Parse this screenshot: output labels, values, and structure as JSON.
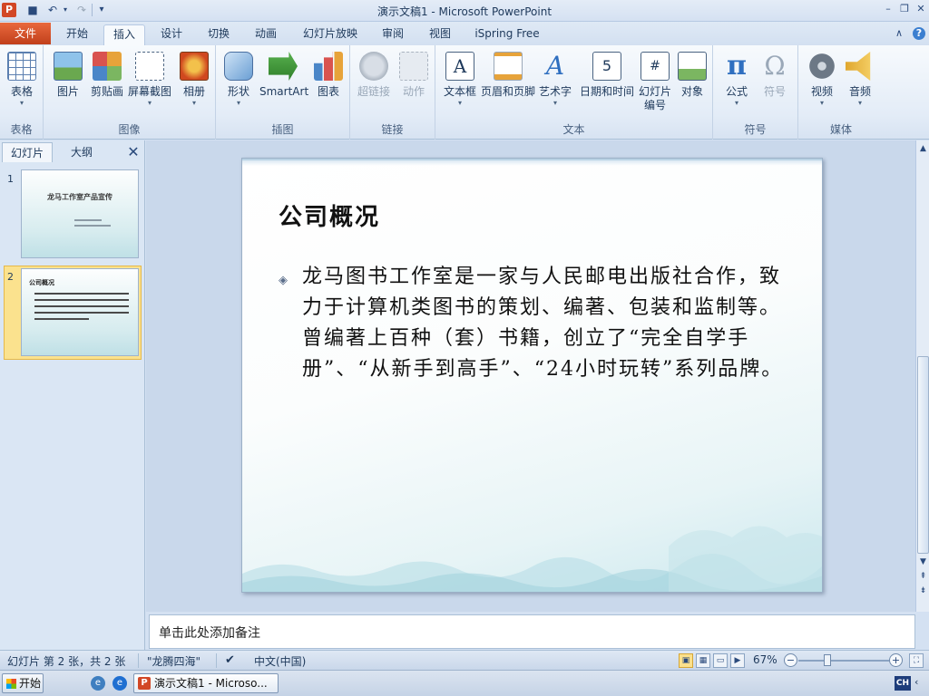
{
  "window": {
    "title": "演示文稿1 - Microsoft PowerPoint",
    "app_icon": "P",
    "qat": {
      "save_icon": "■",
      "undo_icon": "↶",
      "redo_icon": "↷",
      "customize_icon": "▾"
    },
    "controls": {
      "minimize": "–",
      "restore": "❐",
      "close": "✕"
    }
  },
  "tabs": {
    "file": "文件",
    "items": [
      "开始",
      "插入",
      "设计",
      "切换",
      "动画",
      "幻灯片放映",
      "审阅",
      "视图",
      "iSpring Free"
    ],
    "active_index": 1,
    "collapse_icon": "∧",
    "help_icon": "?"
  },
  "ribbon": {
    "groups": {
      "table": "表格",
      "images": "图像",
      "illustrations": "插图",
      "links": "链接",
      "text": "文本",
      "symbols": "符号",
      "media": "媒体"
    },
    "buttons": {
      "table": "表格",
      "picture": "图片",
      "clipart": "剪贴画",
      "screenshot": "屏幕截图",
      "album": "相册",
      "shapes": "形状",
      "smartart": "SmartArt",
      "chart": "图表",
      "hyperlink": "超链接",
      "action": "动作",
      "textbox": "文本框",
      "header_footer": "页眉和页脚",
      "wordart": "艺术字",
      "datetime": "日期和时间",
      "slide_number_1": "幻灯片",
      "slide_number_2": "编号",
      "object": "对象",
      "equation": "公式",
      "symbol": "符号",
      "video": "视频",
      "audio": "音频"
    },
    "glyphs": {
      "wordart": "A",
      "equation": "π",
      "symbol": "Ω",
      "textbox": "A",
      "datetime": "5",
      "slide_number": "#"
    }
  },
  "left_pane": {
    "tabs": [
      "幻灯片",
      "大纲"
    ],
    "close_icon": "✕",
    "slides": [
      {
        "number": "1",
        "title": "龙马工作室产品宣传"
      },
      {
        "number": "2",
        "title": "公司概况"
      }
    ]
  },
  "slide": {
    "title": "公司概况",
    "bullet_icon": "◈",
    "body": "龙马图书工作室是一家与人民邮电出版社合作，致力于计算机类图书的策划、编著、包装和监制等。曾编著上百种（套）书籍，创立了“完全自学手册”、“从新手到高手”、“24小时玩转”系列品牌。"
  },
  "notes": {
    "placeholder": "单击此处添加备注"
  },
  "status": {
    "slide_info": "幻灯片 第 2 张，共 2 张",
    "theme": "\"龙腾四海\"",
    "language": "中文(中国)",
    "zoom": "67%",
    "zoom_out": "−",
    "zoom_in": "+"
  },
  "taskbar": {
    "start": "开始",
    "task": "演示文稿1 - Microso...",
    "task_icon": "P",
    "ime": "CH",
    "tray_icon": "‹"
  }
}
